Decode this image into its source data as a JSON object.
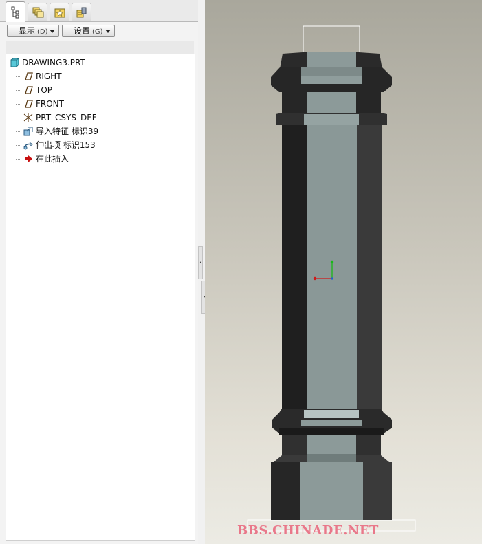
{
  "tabs": [
    {
      "name": "model-tree",
      "icon": "model-tree-icon",
      "active": true
    },
    {
      "name": "folder-browser",
      "icon": "folder-browser-icon",
      "active": false
    },
    {
      "name": "favorites",
      "icon": "favorites-icon",
      "active": false
    },
    {
      "name": "connections",
      "icon": "connections-icon",
      "active": false
    }
  ],
  "toolbar": {
    "show_label": "显示",
    "show_key": "(D)",
    "settings_label": "设置",
    "settings_key": "(G)"
  },
  "tree": {
    "root": "DRAWING3.PRT",
    "items": [
      {
        "label": "RIGHT",
        "icon": "datum-plane-icon"
      },
      {
        "label": "TOP",
        "icon": "datum-plane-icon"
      },
      {
        "label": "FRONT",
        "icon": "datum-plane-icon"
      },
      {
        "label": "PRT_CSYS_DEF",
        "icon": "coordinate-system-icon"
      },
      {
        "label": "导入特征 标识39",
        "icon": "import-feature-icon"
      },
      {
        "label": "伸出项 标识153",
        "icon": "protrusion-icon"
      },
      {
        "label": "在此插入",
        "icon": "insert-here-arrow-icon"
      }
    ]
  },
  "viewport": {
    "watermark": "BBS.CHINADE.NET"
  },
  "colors": {
    "accent_insert": "#c81010",
    "watermark": "#e9788a",
    "model_dark": "#262626",
    "model_face": "#8c9a99"
  }
}
